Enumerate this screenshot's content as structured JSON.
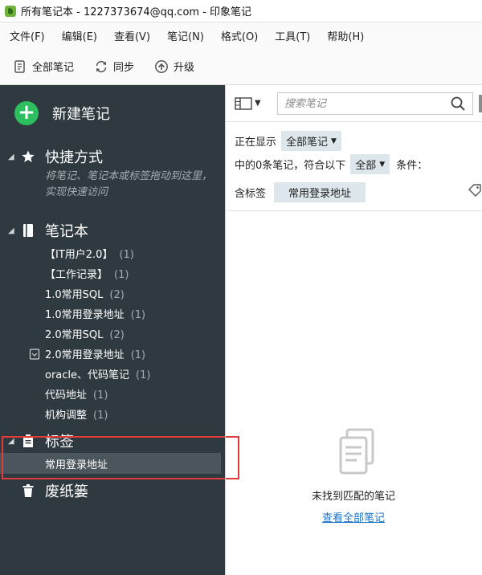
{
  "window": {
    "title": "所有笔记本 - 1227373674@qq.com - 印象笔记"
  },
  "menu": [
    "文件(F)",
    "编辑(E)",
    "查看(V)",
    "笔记(N)",
    "格式(O)",
    "工具(T)",
    "帮助(H)"
  ],
  "toolbar": {
    "all_notes": "全部笔记",
    "sync": "同步",
    "upgrade": "升级"
  },
  "sidebar": {
    "new_note": "新建笔记",
    "shortcuts": "快捷方式",
    "shortcuts_hint": "将笔记、笔记本或标签拖动到这里，实现快速访问",
    "notebooks_label": "笔记本",
    "notebooks": [
      {
        "name": "【IT用户2.0】",
        "count": "(1)"
      },
      {
        "name": "【工作记录】",
        "count": "(1)"
      },
      {
        "name": "1.0常用SQL",
        "count": "(2)"
      },
      {
        "name": "1.0常用登录地址",
        "count": "(1)"
      },
      {
        "name": "2.0常用SQL",
        "count": "(2)"
      },
      {
        "name": "2.0常用登录地址",
        "count": "(1)"
      },
      {
        "name": "oracle、代码笔记",
        "count": "(1)"
      },
      {
        "name": "代码地址",
        "count": "(1)"
      },
      {
        "name": "机构调整",
        "count": "(1)"
      }
    ],
    "tags_label": "标签",
    "tag_selected": "常用登录地址",
    "trash": "废纸篓"
  },
  "search": {
    "placeholder": "搜索笔记"
  },
  "filter": {
    "showing": "正在显示",
    "scope": "全部笔记",
    "line2_pre": "中的0条笔记，符合以下",
    "match": "全部",
    "conditions": "条件：",
    "contains_tag": "含标签",
    "tag": "常用登录地址"
  },
  "empty": {
    "message": "未找到匹配的笔记",
    "link": "查看全部笔记"
  },
  "colors": {
    "sidebar": "#2f3a40",
    "accent_green": "#2dbe60",
    "highlight_box": "#e23b3b",
    "link": "#1a73c9"
  }
}
